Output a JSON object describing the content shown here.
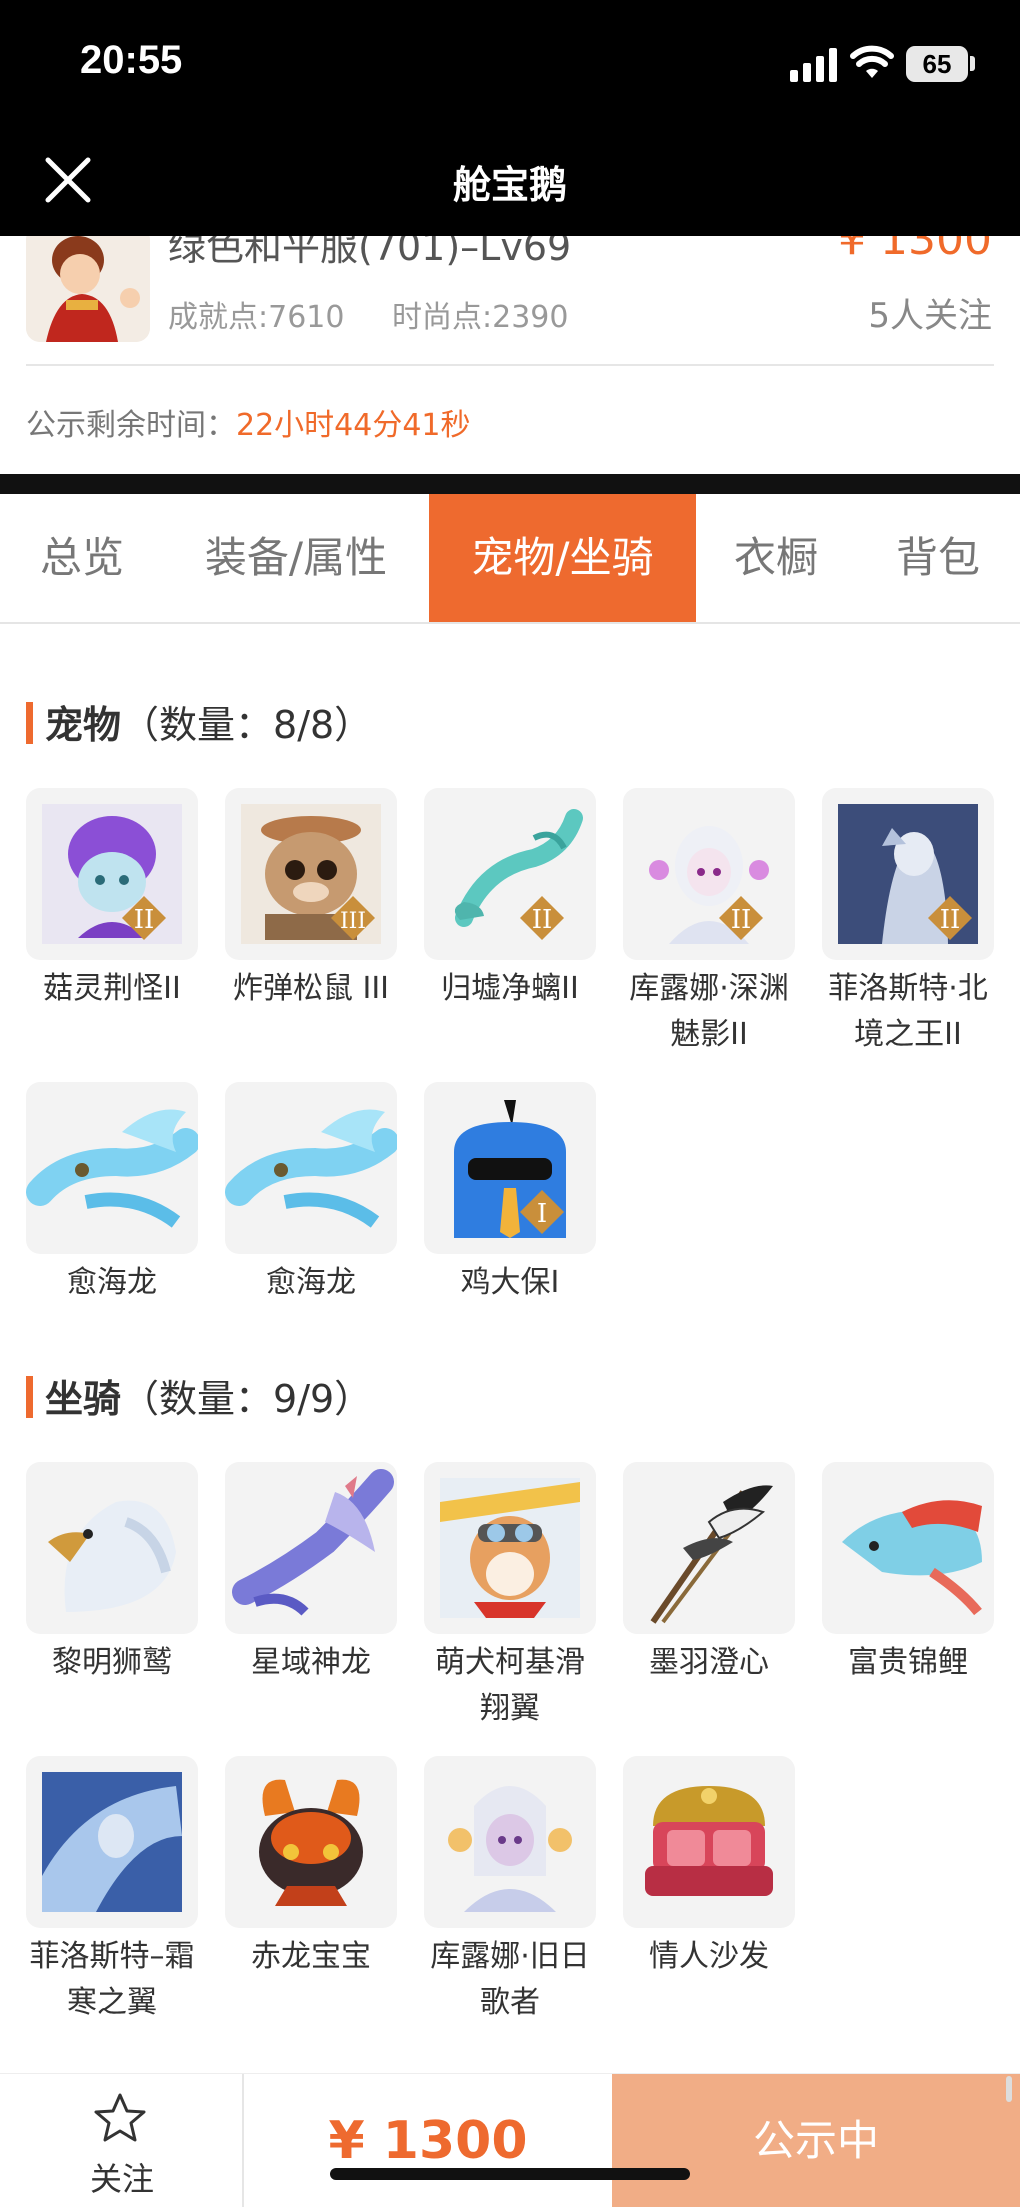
{
  "status_bar": {
    "time": "20:55",
    "battery": "65"
  },
  "nav": {
    "title": "舱宝鹅"
  },
  "summary": {
    "role_name": "绿色和平服(701)–Lv69",
    "achievement": "成就点:7610",
    "fashion": "时尚点:2390",
    "price": "¥ 1300",
    "followers": "5人关注",
    "notice_label": "公示剩余时间：",
    "notice_time": "22小时44分41秒"
  },
  "tabs": [
    {
      "label": "总览",
      "active": false
    },
    {
      "label": "装备/属性",
      "active": false
    },
    {
      "label": "宠物/坐骑",
      "active": true
    },
    {
      "label": "衣橱",
      "active": false
    },
    {
      "label": "背包",
      "active": false
    }
  ],
  "pets": {
    "title": "宠物",
    "count": "（数量：8/8）",
    "items": [
      {
        "name": "菇灵荆怪II",
        "icon": "purple-mushroom-pet-icon",
        "badge": "II"
      },
      {
        "name": "炸弹松鼠 III",
        "icon": "bomb-squirrel-pet-icon",
        "badge": "III"
      },
      {
        "name": "归墟净螭II",
        "icon": "teal-dragon-pet-icon",
        "badge": "II"
      },
      {
        "name": "库露娜·深渊魅影II",
        "icon": "white-spirit-pet-icon",
        "badge": "II"
      },
      {
        "name": "菲洛斯特·北境之王II",
        "icon": "frost-king-pet-icon",
        "badge": "II"
      },
      {
        "name": "愈海龙",
        "icon": "sea-dragon-pet-icon",
        "badge": ""
      },
      {
        "name": "愈海龙",
        "icon": "sea-dragon-pet-icon",
        "badge": ""
      },
      {
        "name": "鸡大保I",
        "icon": "blue-chick-pet-icon",
        "badge": "I"
      }
    ]
  },
  "mounts": {
    "title": "坐骑",
    "count": "（数量：9/9）",
    "items": [
      {
        "name": "黎明狮鹫",
        "icon": "gryphon-mount-icon"
      },
      {
        "name": "星域神龙",
        "icon": "star-dragon-mount-icon"
      },
      {
        "name": "萌犬柯基滑翔翼",
        "icon": "corgi-glider-mount-icon"
      },
      {
        "name": "墨羽澄心",
        "icon": "ink-feather-mount-icon"
      },
      {
        "name": "富贵锦鲤",
        "icon": "koi-mount-icon"
      },
      {
        "name": "菲洛斯特–霜寒之翼",
        "icon": "frost-wing-mount-icon"
      },
      {
        "name": "赤龙宝宝",
        "icon": "red-dragon-mount-icon"
      },
      {
        "name": "库露娜·旧日歌者",
        "icon": "singer-mount-icon"
      },
      {
        "name": "情人沙发",
        "icon": "love-sofa-mount-icon"
      }
    ]
  },
  "bottom": {
    "follow_label": "关注",
    "price": "¥ 1300",
    "status_label": "公示中"
  },
  "colors": {
    "accent": "#ee6a2f",
    "status_button": "#f1ad86"
  }
}
